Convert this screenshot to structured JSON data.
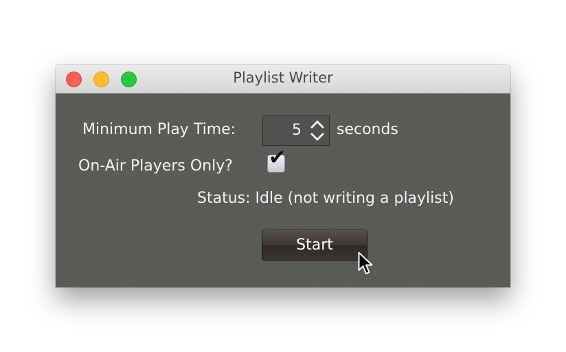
{
  "window": {
    "title": "Playlist Writer"
  },
  "form": {
    "min_play_time_label": "Minimum Play Time:",
    "min_play_time_value": "5",
    "min_play_time_unit": "seconds",
    "on_air_label": "On-Air Players Only?",
    "on_air_checked": true,
    "status_text": "Status: Idle (not writing a playlist)"
  },
  "actions": {
    "start_label": "Start"
  },
  "colors": {
    "close": "#fe5f57",
    "minimize": "#febc2e",
    "zoom": "#28c840",
    "content_background": "#5b5b58"
  },
  "icons": [
    "close-icon",
    "minimize-icon",
    "zoom-icon",
    "up-down-arrows-icon",
    "checkmark-icon",
    "mouse-pointer-icon"
  ]
}
